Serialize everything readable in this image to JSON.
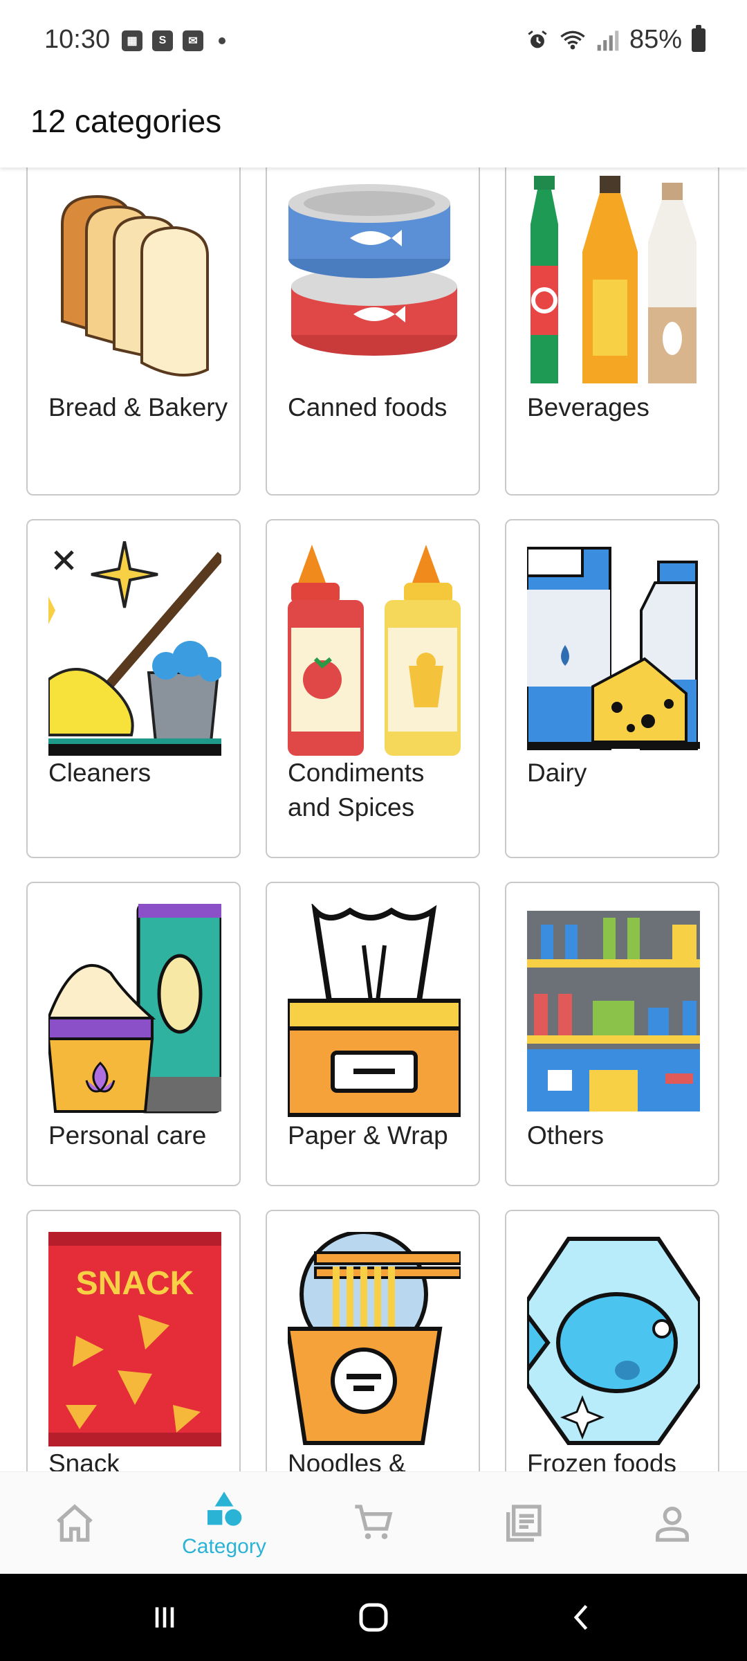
{
  "status_bar": {
    "time": "10:30",
    "notification_icons": [
      "calendar-icon",
      "shop-icon",
      "mail-icon"
    ],
    "battery": "85%"
  },
  "header": {
    "title": "12 categories"
  },
  "categories": [
    {
      "label": "Bread & Bakery",
      "icon": "bread-icon"
    },
    {
      "label": "Canned foods",
      "icon": "canned-food-icon"
    },
    {
      "label": "Beverages",
      "icon": "bottles-icon"
    },
    {
      "label": "Cleaners",
      "icon": "cleaning-mop-icon"
    },
    {
      "label": "Condiments and Spices",
      "icon": "sauce-bottles-icon"
    },
    {
      "label": "Dairy",
      "icon": "milk-cheese-icon"
    },
    {
      "label": "Personal care",
      "icon": "cream-tube-icon"
    },
    {
      "label": "Paper & Wrap",
      "icon": "tissue-box-icon"
    },
    {
      "label": "Others",
      "icon": "store-shelf-icon"
    },
    {
      "label": "Snack",
      "icon": "snack-bag-icon",
      "image_text": "SNACK"
    },
    {
      "label": "Noodles &",
      "icon": "noodle-cup-icon"
    },
    {
      "label": "Frozen foods",
      "icon": "frozen-fish-icon"
    }
  ],
  "bottom_nav": {
    "items": [
      {
        "icon": "home-icon",
        "label": ""
      },
      {
        "icon": "category-icon",
        "label": "Category",
        "active": true
      },
      {
        "icon": "cart-icon",
        "label": ""
      },
      {
        "icon": "orders-icon",
        "label": ""
      },
      {
        "icon": "account-icon",
        "label": ""
      }
    ]
  },
  "colors": {
    "accent": "#2bb3d6",
    "card_border": "#c9c9c9"
  }
}
